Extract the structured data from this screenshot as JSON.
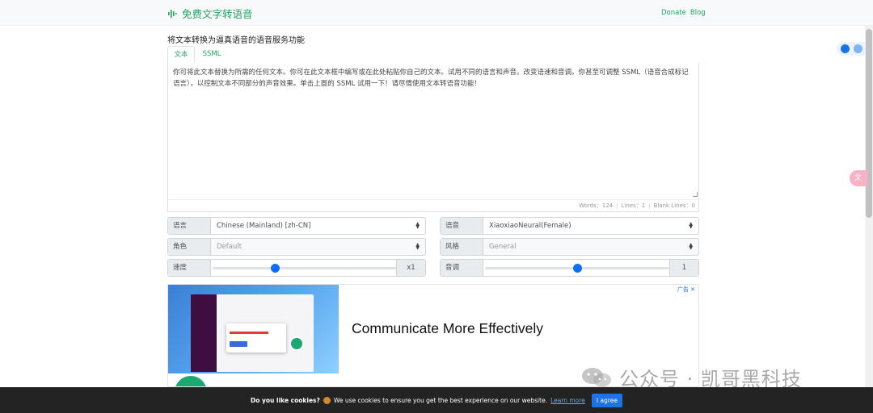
{
  "nav": {
    "brand": "免费文字转语音",
    "links": [
      "Donate",
      "Blog"
    ],
    "accent": "#20a464"
  },
  "heading": "将文本转换为逼真语音的语音服务功能",
  "tabs": [
    {
      "label": "文本",
      "active": true
    },
    {
      "label": "SSML",
      "active": false
    }
  ],
  "editor": {
    "text": "你可将此文本替换为所需的任何文本。你可在此文本框中编写或在此处粘贴你自己的文本。试用不同的语言和声音。改变语速和音调。你甚至可调整 SSML（语音合成标记语言），以控制文本不同部分的声音效果。单击上面的 SSML 试用一下！请尽情使用文本转语音功能！",
    "stats": {
      "words": "Words：124",
      "lines": "Lines：1",
      "blank": "Blank Lines：0"
    }
  },
  "controls": {
    "language": {
      "label": "语言",
      "value": "Chinese (Mainland) [zh-CN]"
    },
    "voice": {
      "label": "语音",
      "value": "XiaoxiaoNeural(Female)"
    },
    "role": {
      "label": "角色",
      "value": "Default"
    },
    "style": {
      "label": "风格",
      "value": "General"
    },
    "speed": {
      "label": "速度",
      "value": "x1",
      "level": 0.34
    },
    "pitch": {
      "label": "音调",
      "value": "1",
      "level": 0.5
    }
  },
  "ad": {
    "headline": "Communicate More Effectively",
    "badge": "广告 ✕"
  },
  "watermark": "公众号 · 凯哥黑科技",
  "float_translate": "文",
  "cookie": {
    "question": "Do you like cookies?",
    "message": "We use cookies to ensure you get the best experience on our website.",
    "learn_more": "Learn more",
    "agree": "I agree"
  }
}
